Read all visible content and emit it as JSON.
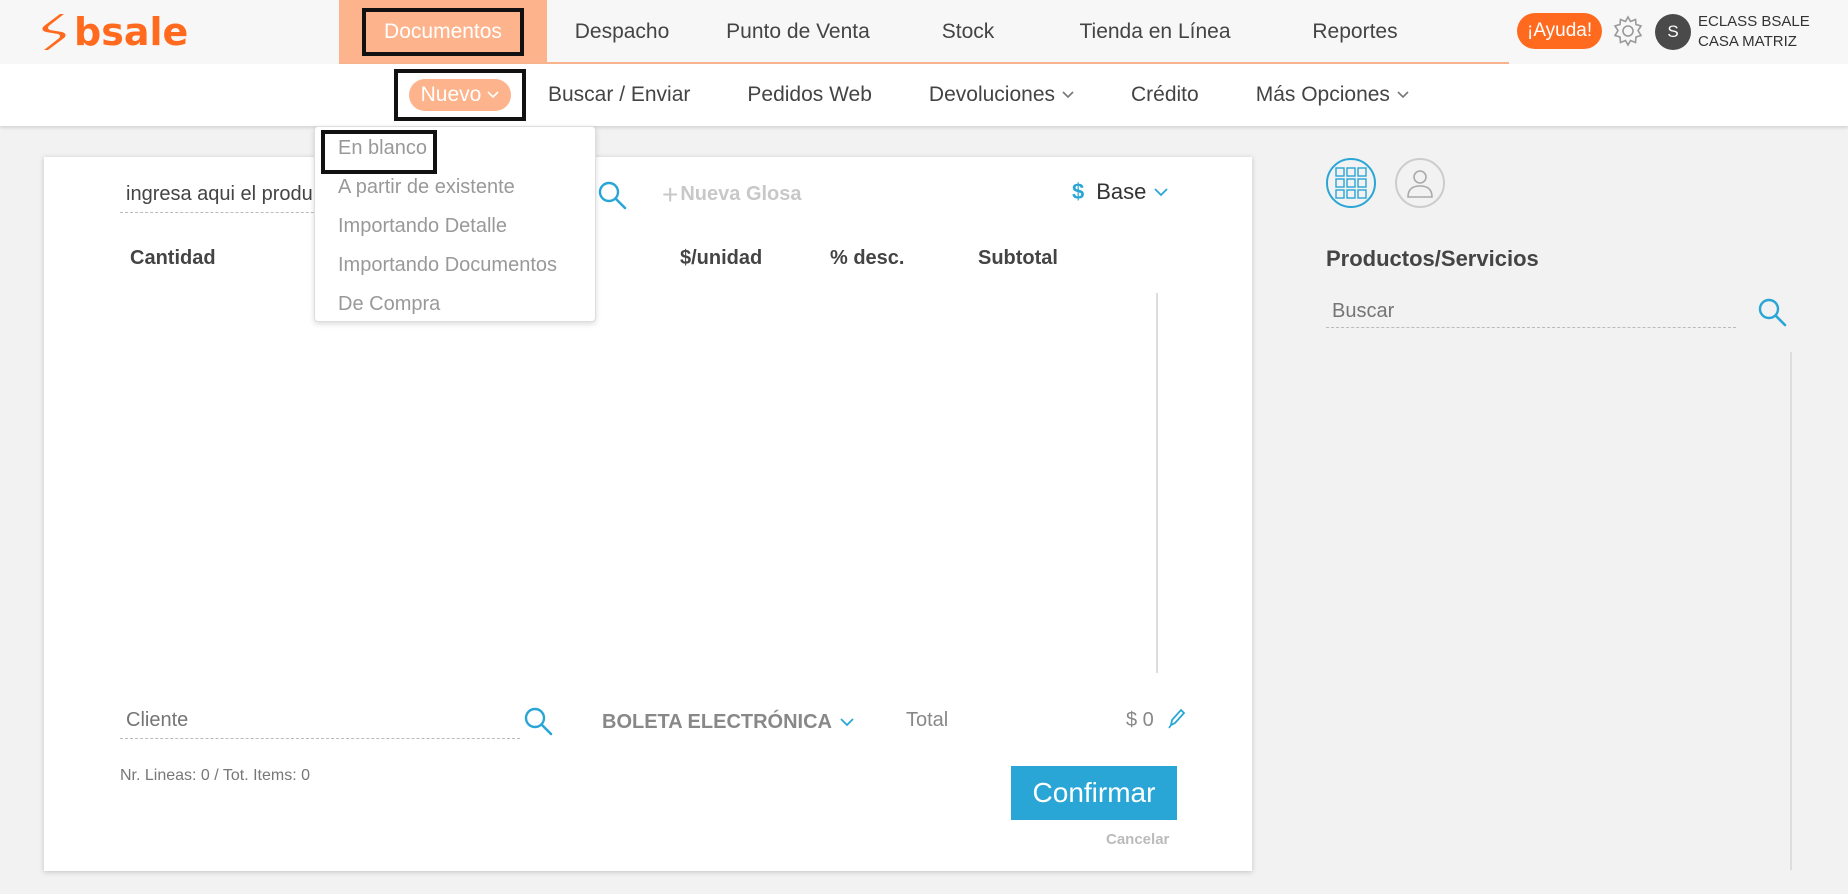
{
  "brand": {
    "name": "bsale",
    "color": "#ff6a1f"
  },
  "main_nav": {
    "items": [
      {
        "label": "Documentos",
        "active": true
      },
      {
        "label": "Despacho"
      },
      {
        "label": "Punto de Venta"
      },
      {
        "label": "Stock"
      },
      {
        "label": "Tienda en Línea"
      },
      {
        "label": "Reportes"
      }
    ],
    "active_color": "#fdb38b"
  },
  "header": {
    "help_label": "¡Ayuda!",
    "settings_icon": "gear-icon",
    "avatar_initial": "S",
    "company_line1": "ECLASS BSALE",
    "company_line2": "CASA MATRIZ"
  },
  "sub_nav": {
    "items": [
      {
        "label": "Nuevo",
        "has_chevron": true,
        "active": true
      },
      {
        "label": "Buscar / Enviar"
      },
      {
        "label": "Pedidos Web"
      },
      {
        "label": "Devoluciones",
        "has_chevron": true
      },
      {
        "label": "Crédito"
      },
      {
        "label": "Más Opciones",
        "has_chevron": true
      }
    ]
  },
  "nuevo_menu": {
    "items": [
      "En blanco",
      "A partir de existente",
      "Importando Detalle",
      "Importando Documentos",
      "De Compra"
    ]
  },
  "document": {
    "product_input_value": "ingresa aqui el produ",
    "new_gloss_label": "Nueva Glosa",
    "currency_symbol": "$",
    "price_list": "Base",
    "columns": [
      "Cantidad",
      "$/unidad",
      "% desc.",
      "Subtotal"
    ],
    "client_placeholder": "Cliente",
    "doc_type": "BOLETA ELECTRÓNICA",
    "total_label": "Total",
    "total_value": "$ 0",
    "line_count": "Nr. Lineas: 0 / Tot. Items: 0",
    "confirm_label": "Confirmar",
    "cancel_label": "Cancelar",
    "accent_color": "#2aa6d6"
  },
  "right_panel": {
    "title": "Productos/Servicios",
    "search_placeholder": "Buscar"
  }
}
